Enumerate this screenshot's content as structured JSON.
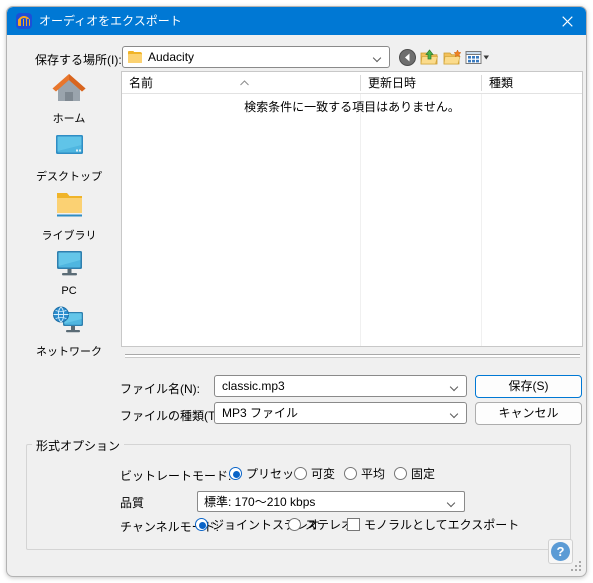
{
  "window": {
    "title": "オーディオをエクスポート",
    "app_icon": "audacity-headphones-icon",
    "close_label": "✕",
    "accent_color": "#0078d4",
    "background_color": "#f0f0f0"
  },
  "saveto": {
    "label": "保存する場所(I):",
    "value": "Audacity",
    "icon": "folder-icon"
  },
  "toolbar": {
    "back": "back-icon",
    "up": "up-folder-icon",
    "new_folder": "new-folder-icon",
    "views": "views-icon"
  },
  "sidebar": {
    "items": [
      {
        "label": "ホーム",
        "icon": "home-icon"
      },
      {
        "label": "デスクトップ",
        "icon": "desktop-icon"
      },
      {
        "label": "ライブラリ",
        "icon": "library-folder-icon"
      },
      {
        "label": "PC",
        "icon": "pc-monitor-icon"
      },
      {
        "label": "ネットワーク",
        "icon": "network-icon"
      }
    ]
  },
  "filelist": {
    "columns": [
      {
        "label": "名前",
        "sorted": "asc"
      },
      {
        "label": "更新日時",
        "sorted": ""
      },
      {
        "label": "種類",
        "sorted": ""
      }
    ],
    "rows": [],
    "empty_message": "検索条件に一致する項目はありません。"
  },
  "filename": {
    "label": "ファイル名(N):",
    "value": "classic.mp3"
  },
  "filetype": {
    "label": "ファイルの種類(T):",
    "value": "MP3 ファイル"
  },
  "buttons": {
    "save": "保存(S)",
    "cancel": "キャンセル"
  },
  "format_options": {
    "group_title": "形式オプション",
    "bitrate_mode": {
      "label": "ビットレートモード:",
      "options": [
        "プリセット",
        "可変",
        "平均",
        "固定"
      ],
      "selected": "プリセット"
    },
    "quality": {
      "label": "品質",
      "value": "標準: 170〜210 kbps"
    },
    "channel_mode": {
      "label": "チャンネルモード:",
      "options": [
        "ジョイントステレオ",
        "ステレオ"
      ],
      "selected": "ジョイントステレオ",
      "mono_checkbox_label": "モノラルとしてエクスポート",
      "mono_checked": false
    }
  },
  "help": {
    "label": "?"
  }
}
